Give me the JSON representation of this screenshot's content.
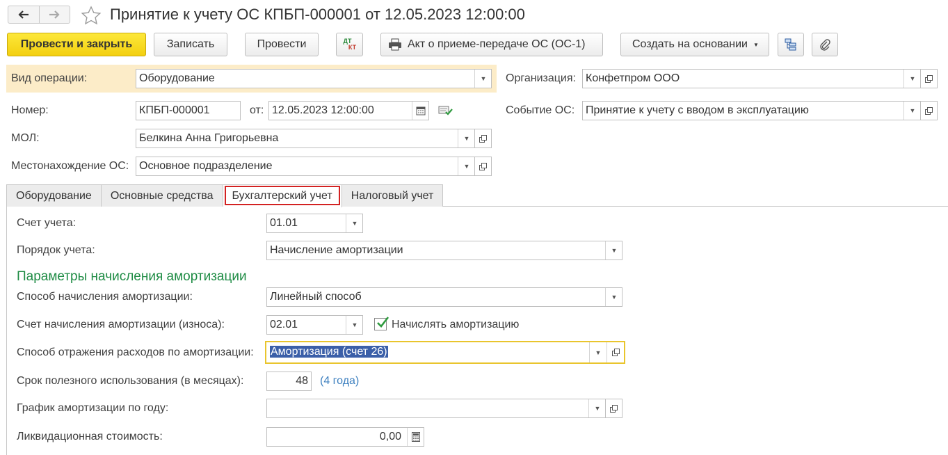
{
  "window": {
    "title": "Принятие к учету ОС КПБП-000001 от 12.05.2023 12:00:00"
  },
  "nav": {
    "back_icon": "arrow-left-icon",
    "forward_icon": "arrow-right-icon",
    "favorite_icon": "star-icon"
  },
  "toolbar": {
    "post_close": "Провести и закрыть",
    "save": "Записать",
    "post": "Провести",
    "dtkt_top": "ДТ",
    "dtkt_bottom": "КТ",
    "print_act": "Акт о приеме-передаче ОС (ОС-1)",
    "create_based": "Создать на основании",
    "structure_icon": "document-structure-icon",
    "attach_icon": "paperclip-icon"
  },
  "header": {
    "op_type_label": "Вид операции:",
    "op_type_value": "Оборудование",
    "org_label": "Организация:",
    "org_value": "Конфетпром ООО",
    "number_label": "Номер:",
    "number_value": "КПБП-000001",
    "date_label": "от:",
    "date_value": "12.05.2023 12:00:00",
    "event_label": "Событие ОС:",
    "event_value": "Принятие к учету с вводом в эксплуатацию",
    "mol_label": "МОЛ:",
    "mol_value": "Белкина Анна Григорьевна",
    "location_label": "Местонахождение ОС:",
    "location_value": "Основное подразделение"
  },
  "tabs": [
    {
      "label": "Оборудование",
      "active": false
    },
    {
      "label": "Основные средства",
      "active": false
    },
    {
      "label": "Бухгалтерский учет",
      "active": true
    },
    {
      "label": "Налоговый учет",
      "active": false
    }
  ],
  "accounting": {
    "account_label": "Счет учета:",
    "account_value": "01.01",
    "order_label": "Порядок учета:",
    "order_value": "Начисление амортизации",
    "section_title": "Параметры начисления амортизации",
    "method_label": "Способ начисления амортизации:",
    "method_value": "Линейный способ",
    "amort_account_label": "Счет начисления амортизации (износа):",
    "amort_account_value": "02.01",
    "accrue_checkbox_label": "Начислять амортизацию",
    "accrue_checked": true,
    "expense_label": "Способ отражения расходов по амортизации:",
    "expense_value": "Амортизация (счет 26)",
    "life_label": "Срок полезного использования (в месяцах):",
    "life_value": "48",
    "life_hint": "(4 года)",
    "schedule_label": "График амортизации по году:",
    "schedule_value": "",
    "liquidation_label": "Ликвидационная стоимость:",
    "liquidation_value": "0,00"
  },
  "colors": {
    "primary_button": "#f5d31a",
    "operation_strip": "#fcecc8",
    "section_title": "#1f8c45",
    "tab_highlight": "#d32222",
    "focus_border": "#e9c52d",
    "selection": "#3b5fa8",
    "link": "#3c7fbf"
  }
}
